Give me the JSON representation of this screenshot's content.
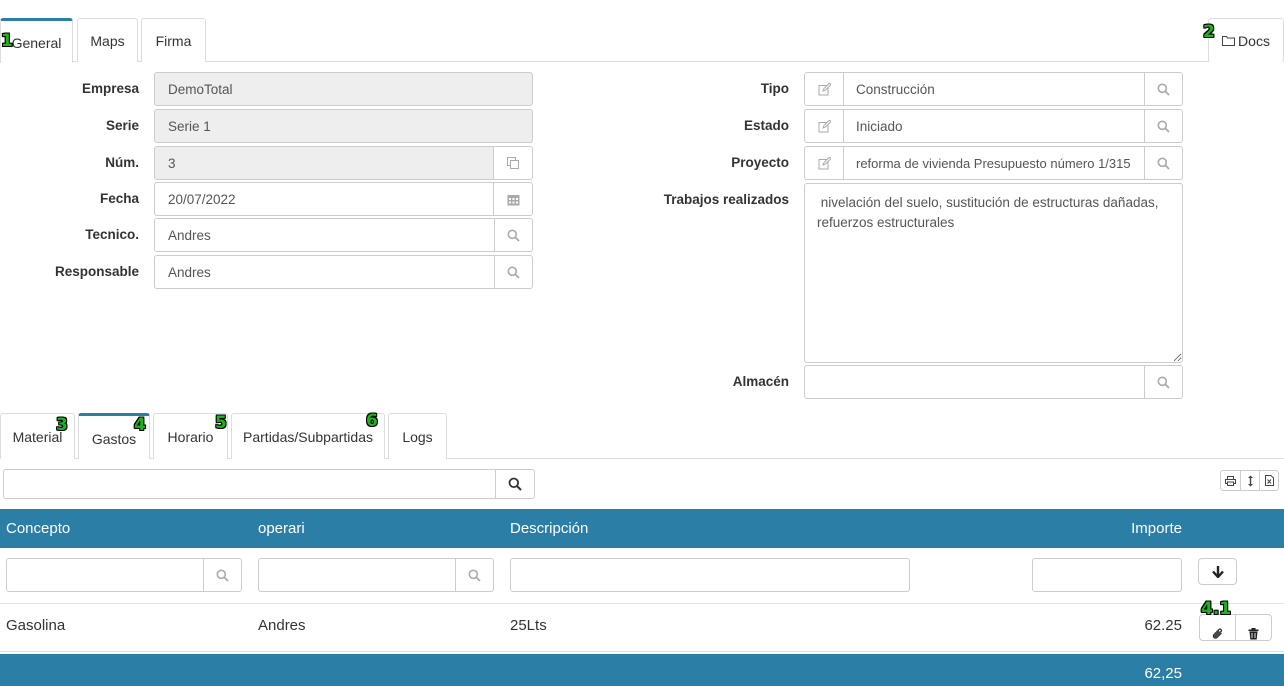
{
  "top_tabs": {
    "general": "General",
    "maps": "Maps",
    "firma": "Firma",
    "docs": "Docs"
  },
  "badges": {
    "b1": "1",
    "b2": "2",
    "b3": "3",
    "b4": "4",
    "b5": "5",
    "b6": "6",
    "b41": "4.1"
  },
  "form": {
    "empresa_label": "Empresa",
    "empresa_value": "DemoTotal",
    "serie_label": "Serie",
    "serie_value": "Serie 1",
    "num_label": "Núm.",
    "num_value": "3",
    "fecha_label": "Fecha",
    "fecha_value": "20/07/2022",
    "tecnico_label": "Tecnico.",
    "tecnico_value": "Andres",
    "responsable_label": "Responsable",
    "responsable_value": "Andres",
    "tipo_label": "Tipo",
    "tipo_value": "Construcción",
    "estado_label": "Estado",
    "estado_value": "Iniciado",
    "proyecto_label": "Proyecto",
    "proyecto_value": "reforma de vivienda Presupuesto número 1/315",
    "trabajos_label": "Trabajos realizados",
    "trabajos_value": " nivelación del suelo, sustitución de estructuras dañadas, refuerzos estructurales",
    "almacen_label": "Almacén",
    "almacen_value": ""
  },
  "bottom_tabs": {
    "material": "Material",
    "gastos": "Gastos",
    "horario": "Horario",
    "partidas": "Partidas/Subpartidas",
    "logs": "Logs"
  },
  "table": {
    "headers": {
      "concepto": "Concepto",
      "operari": "operari",
      "descripcion": "Descripción",
      "importe": "Importe"
    },
    "rows": [
      {
        "concepto": "Gasolina",
        "operari": "Andres",
        "descripcion": "25Lts",
        "importe": "62.25"
      }
    ],
    "total": "62,25"
  },
  "colors": {
    "accent": "#2b7ea6",
    "badge": "#1db31d"
  }
}
